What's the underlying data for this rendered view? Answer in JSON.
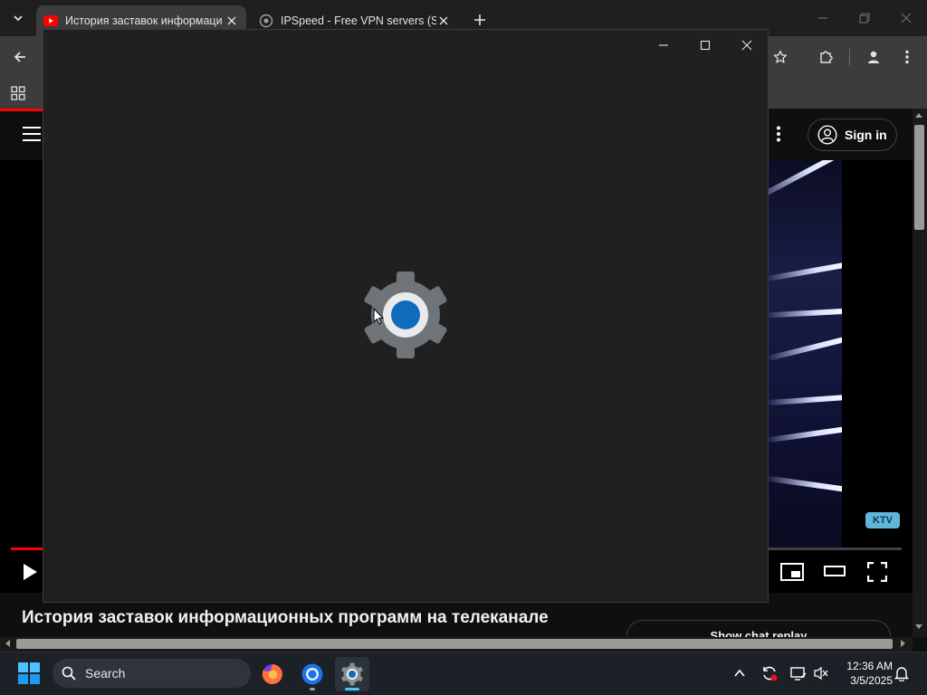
{
  "browser": {
    "tabs": [
      {
        "title": "История заставок информаци",
        "active": true
      },
      {
        "title": "IPSpeed - Free VPN servers (SS",
        "active": false
      }
    ]
  },
  "youtube": {
    "sign_in": "Sign in",
    "video_title": "История заставок информационных программ на телеканале",
    "show_chat_replay": "Show chat replay",
    "channel_badge": "KTV",
    "progress_fraction": 0.036
  },
  "settings_window": {
    "app": "Settings",
    "icon": "settings-gear-icon"
  },
  "taskbar": {
    "search_label": "Search",
    "apps": [
      "firefox-icon",
      "chrome-icon",
      "settings-gear-icon"
    ],
    "time": "12:36 AM",
    "date": "3/5/2025"
  },
  "colors": {
    "accent_blue": "#0f6cbd",
    "youtube_red": "#ff0000",
    "window_bg": "#202020"
  }
}
